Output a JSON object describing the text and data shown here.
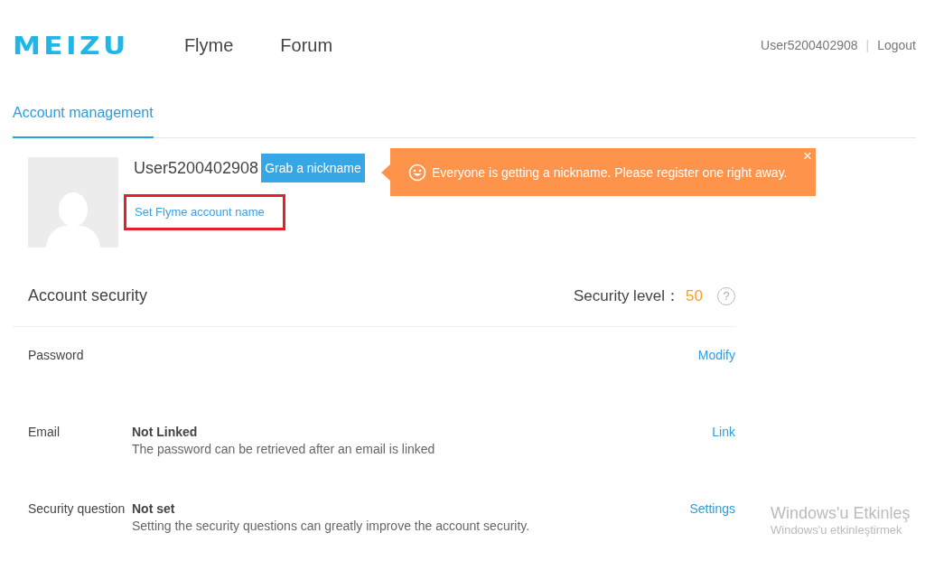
{
  "header": {
    "logo": "MEIZU",
    "nav": [
      {
        "label": "Flyme"
      },
      {
        "label": "Forum"
      }
    ],
    "user": "User5200402908",
    "separator": "|",
    "logout": "Logout"
  },
  "tabs": [
    {
      "label": "Account management",
      "selected": true
    }
  ],
  "profile": {
    "username": "User5200402908",
    "nickname_button": "Grab a nickname",
    "account_name_link": "Set Flyme account name",
    "highlighted": true
  },
  "toast": {
    "message": "Everyone is getting a nickname. Please register one right away.",
    "close": "×"
  },
  "security": {
    "title": "Account security",
    "level_label": "Security level：",
    "level_value": "50",
    "help": "?",
    "rows": [
      {
        "label": "Password",
        "action": "Modify"
      },
      {
        "label": "Email",
        "status": "Not Linked",
        "description": "The password can be retrieved after an email is linked",
        "action": "Link"
      },
      {
        "label": "Security question",
        "status": "Not set",
        "description": "Setting the security questions can greatly improve the account security.",
        "action": "Settings"
      }
    ]
  },
  "activation_notice": {
    "title": "Windows'u Etkinleş",
    "text": "Windows'u etkinleştirmek"
  }
}
